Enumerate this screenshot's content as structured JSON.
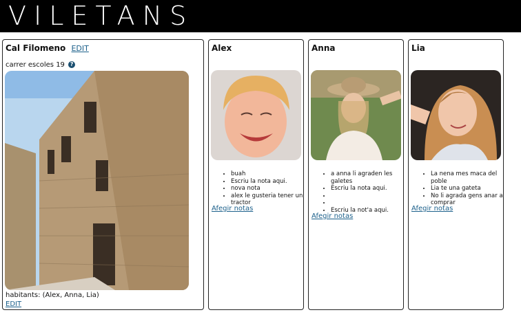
{
  "header": {
    "brand": "VILETANS"
  },
  "house": {
    "title": "Cal Filomeno",
    "edit_label": "EDIT",
    "address": "carrer escoles 19",
    "info_icon": "question-circle-icon",
    "residents_text": "habitants: (Alex, Anna, Lia)",
    "edit_residents_label": "EDIT"
  },
  "people": [
    {
      "name": "Alex",
      "notes": [
        "buah",
        "Escriu la nota aqui.",
        "nova nota",
        "alex le gusteria tener un tractor"
      ],
      "add_notes_label": "Afegir notas"
    },
    {
      "name": "Anna",
      "notes": [
        "a anna li agraden les galetes",
        "Escriu la nota aqui.",
        "",
        "",
        "Escriu la not'a aqui."
      ],
      "add_notes_label": "Afegir notas"
    },
    {
      "name": "Lia",
      "notes": [
        "La nena mes maca del poble",
        "Lia te una gateta",
        "No li agrada gens anar a comprar"
      ],
      "add_notes_label": "Afegir notas"
    }
  ]
}
